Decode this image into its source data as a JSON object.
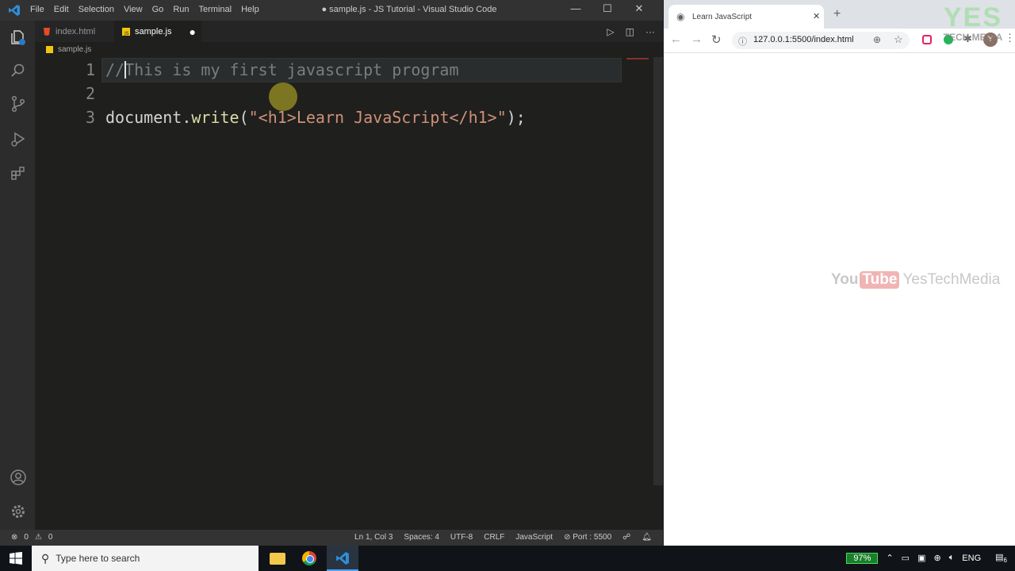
{
  "vscode": {
    "menu": [
      "File",
      "Edit",
      "Selection",
      "View",
      "Go",
      "Run",
      "Terminal",
      "Help"
    ],
    "window_title": "● sample.js - JS Tutorial - Visual Studio Code",
    "tabs": [
      {
        "label": "index.html",
        "icon": "html-file-icon",
        "color": "#e44d26"
      },
      {
        "label": "sample.js",
        "icon": "js-file-icon",
        "color": "#f1c40f",
        "modified": true
      }
    ],
    "breadcrumb": "sample.js",
    "code": {
      "line_numbers": [
        "1",
        "2",
        "3"
      ],
      "line1_comment": "//This is my first javascript program",
      "line3": {
        "obj": "document",
        "dot": ".",
        "method": "write",
        "open": "(",
        "string": "\"<h1>Learn JavaScript</h1>\"",
        "close": ");"
      }
    },
    "status": {
      "errors": "0",
      "warnings": "0",
      "position": "Ln 1, Col 3",
      "spaces": "Spaces: 4",
      "encoding": "UTF-8",
      "eol": "CRLF",
      "language": "JavaScript",
      "port": "Port : 5500"
    }
  },
  "browser": {
    "tab_title": "Learn JavaScript",
    "url": "127.0.0.1:5500/index.html",
    "watermark_yt_you": "You",
    "watermark_yt_tube": "Tube",
    "watermark_channel": "YesTechMedia",
    "logo_yes": "YES",
    "logo_tech_media": "TECH MEDIA",
    "avatar_letter": "Y"
  },
  "taskbar": {
    "search_placeholder": "Type here to search",
    "battery": "97%",
    "language": "ENG",
    "notification_count": "6"
  },
  "colors": {
    "editor_bg": "#1f1f1d",
    "comment": "#7c7c7c",
    "keyword_default": "#d4d4d4",
    "method": "#dcdcaa",
    "string": "#ce9178"
  }
}
